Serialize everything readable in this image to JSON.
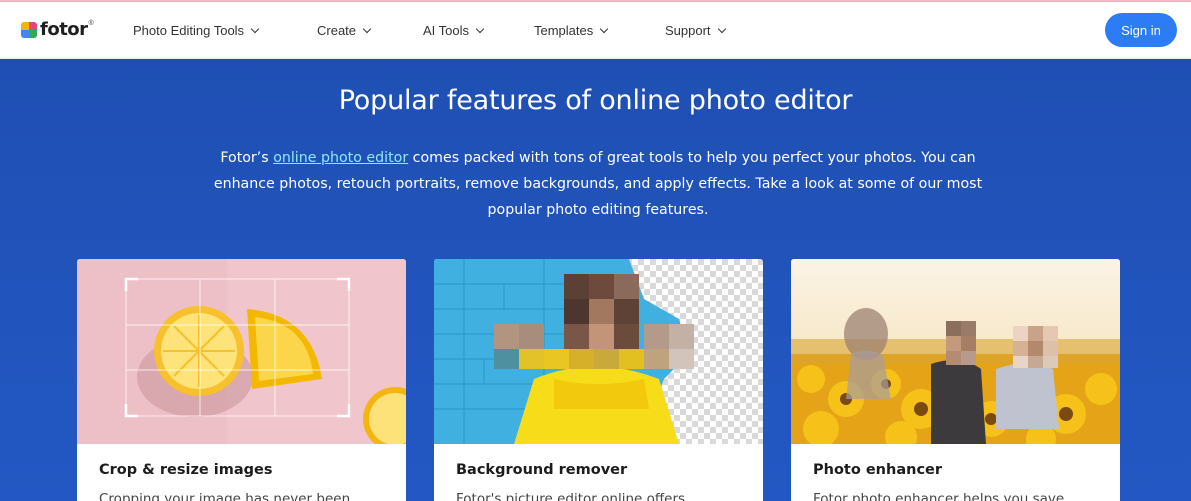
{
  "brand": {
    "name": "fotor",
    "reg": "®",
    "logo_colors": [
      "#f4b400",
      "#e9447a",
      "#4285f4",
      "#34a853"
    ]
  },
  "nav": {
    "items": [
      {
        "label": "Photo Editing Tools"
      },
      {
        "label": "Create"
      },
      {
        "label": "AI Tools"
      },
      {
        "label": "Templates"
      },
      {
        "label": "Support"
      }
    ],
    "signin_label": "Sign in"
  },
  "hero": {
    "title": "Popular features of online photo editor",
    "desc_before": "Fotor’s ",
    "desc_link": "online photo editor",
    "desc_line1_rest": " comes packed with tons of great tools to help you perfect your photos. You can",
    "desc_line2": "enhance photos, retouch portraits, remove backgrounds, and apply effects. Take a look at some of our most",
    "desc_line3": "popular photo editing features."
  },
  "cards": [
    {
      "title": "Crop & resize images",
      "text": "Cropping your image has never been"
    },
    {
      "title": "Background remover",
      "text": "Fotor's picture editor online offers"
    },
    {
      "title": "Photo enhancer",
      "text": "Fotor photo enhancer helps you save"
    }
  ],
  "colors": {
    "accent": "#2c7cf6",
    "hero_bg": "#2253b8",
    "link": "#8fe8ff"
  }
}
